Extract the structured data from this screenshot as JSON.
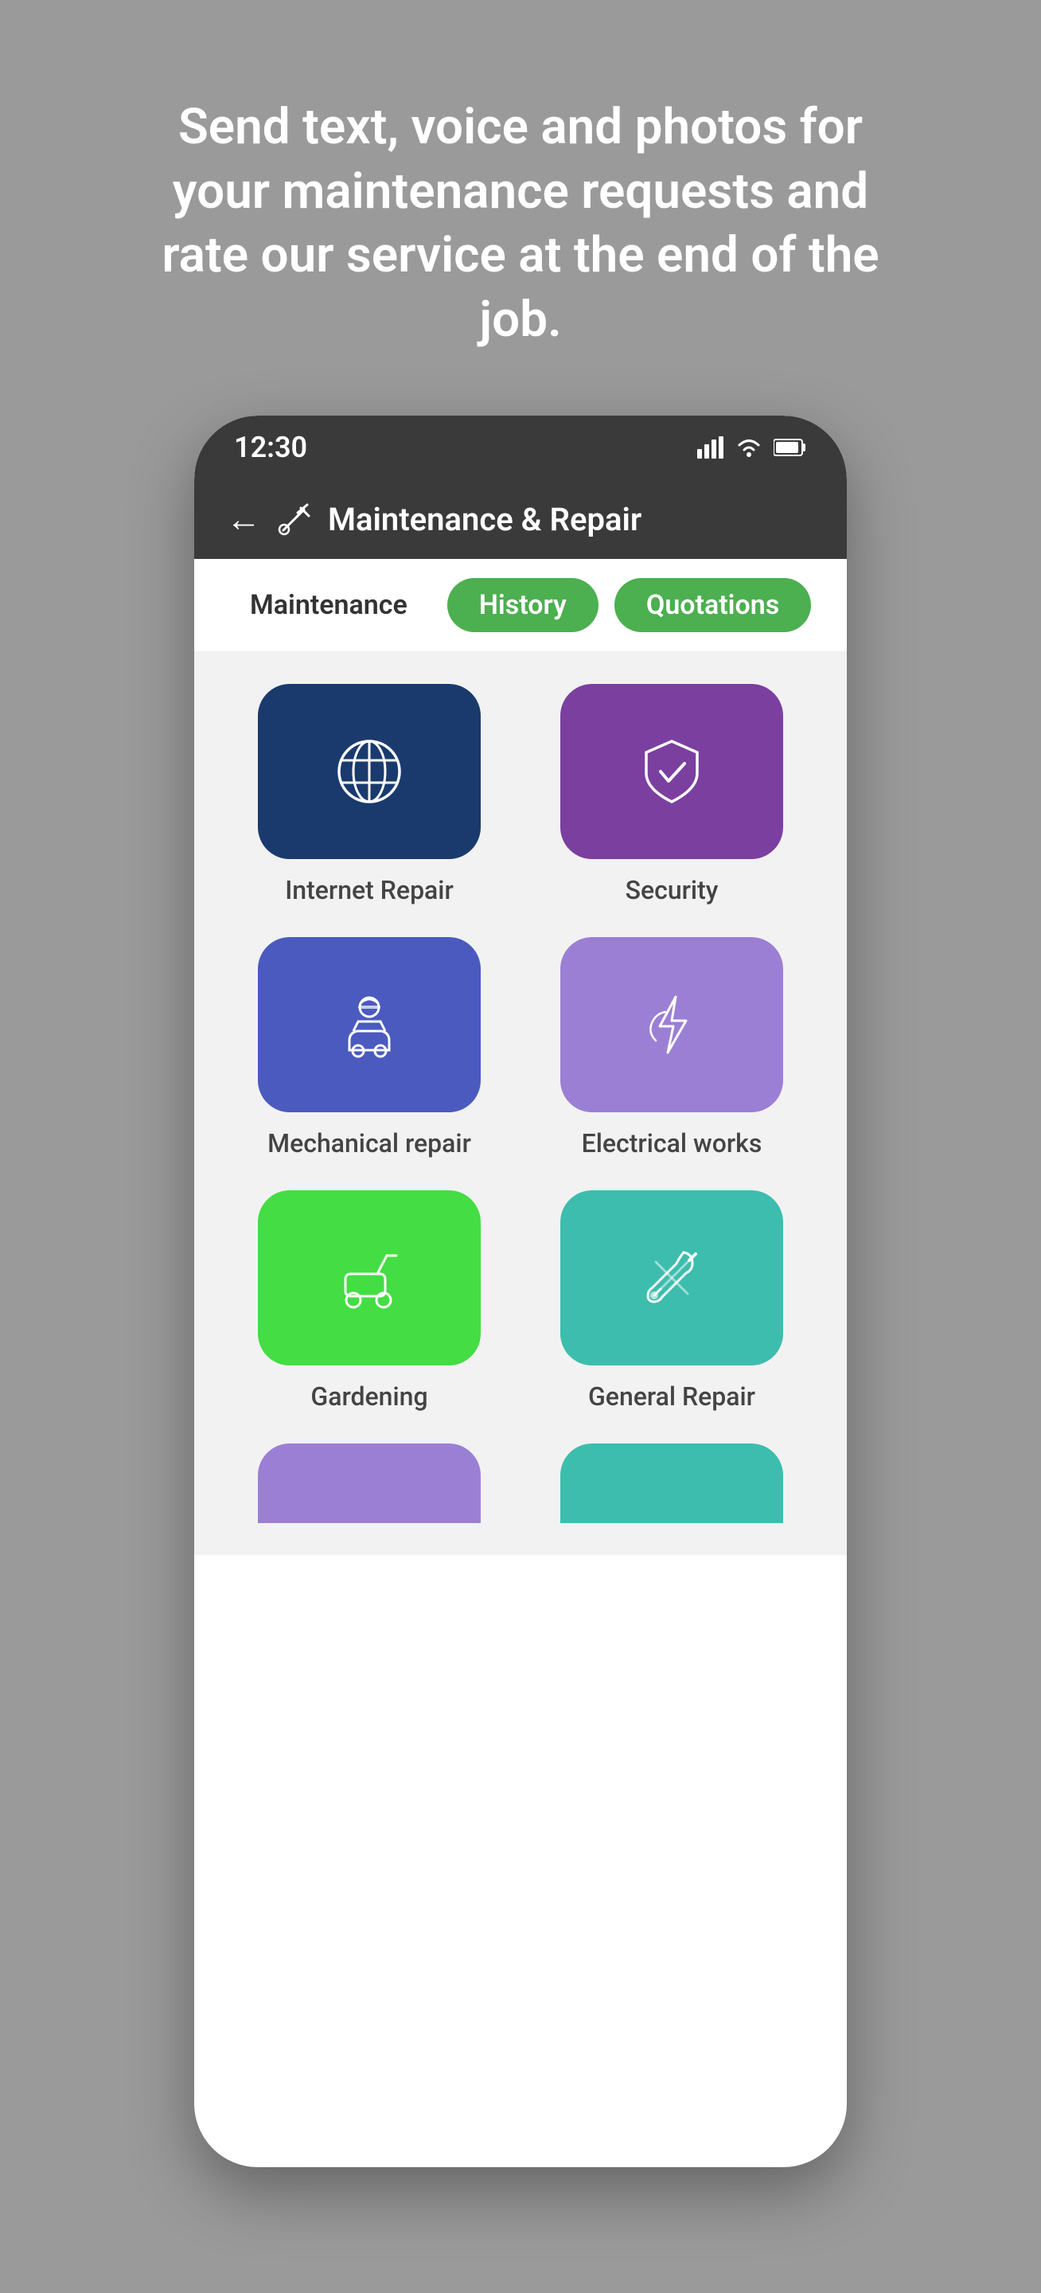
{
  "hero": {
    "text": "Send text, voice and photos for your maintenance requests and rate our service at the end of the job."
  },
  "status_bar": {
    "time": "12:30",
    "signal": "▌▌▌",
    "wifi": "WiFi",
    "battery": "🔋"
  },
  "app_bar": {
    "title": "Maintenance & Repair",
    "back_label": "←"
  },
  "tabs": {
    "maintenance": "Maintenance",
    "history": "History",
    "quotations": "Quotations"
  },
  "services": [
    {
      "id": "internet-repair",
      "label": "Internet Repair",
      "card_class": "card-internet"
    },
    {
      "id": "security",
      "label": "Security",
      "card_class": "card-security"
    },
    {
      "id": "mechanical-repair",
      "label": "Mechanical repair",
      "card_class": "card-mechanical"
    },
    {
      "id": "electrical-works",
      "label": "Electrical works",
      "card_class": "card-electrical"
    },
    {
      "id": "gardening",
      "label": "Gardening",
      "card_class": "card-gardening"
    },
    {
      "id": "general-repair",
      "label": "General Repair",
      "card_class": "card-general"
    }
  ]
}
